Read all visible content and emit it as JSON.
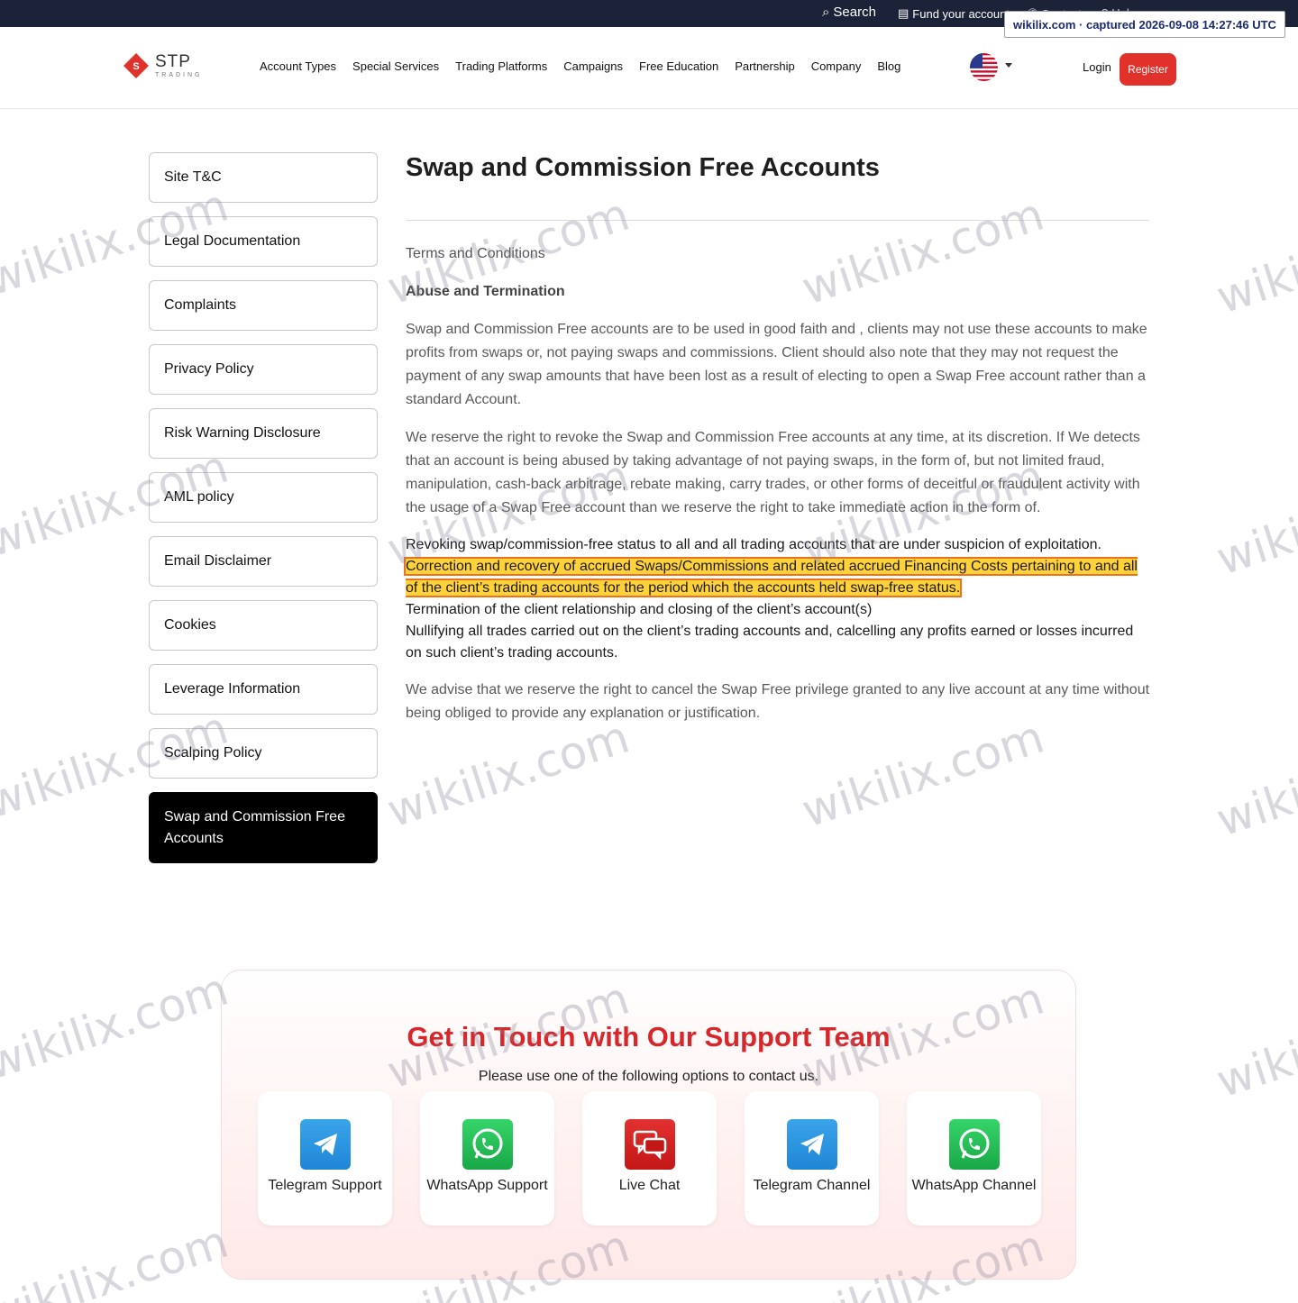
{
  "topbar": {
    "search": "Search",
    "fund": "Fund your account",
    "contact": "Contact",
    "help": "Help",
    "capture": "wikilix.com · captured 2026-09-08 14:27:46 UTC"
  },
  "header": {
    "logo_name": "STP",
    "logo_sub": "TRADING",
    "nav": [
      "Account Types",
      "Special Services",
      "Trading Platforms",
      "Campaigns",
      "Free Education",
      "Partnership",
      "Company",
      "Blog"
    ],
    "login": "Login",
    "register": "Register"
  },
  "sidebar": {
    "items": [
      {
        "label": "Site T&C"
      },
      {
        "label": "Legal Documentation"
      },
      {
        "label": "Complaints"
      },
      {
        "label": "Privacy Policy"
      },
      {
        "label": "Risk Warning Disclosure"
      },
      {
        "label": "AML policy"
      },
      {
        "label": "Email Disclaimer"
      },
      {
        "label": "Cookies"
      },
      {
        "label": "Leverage Information"
      },
      {
        "label": "Scalping Policy"
      },
      {
        "label": "Swap and Commission Free Accounts"
      }
    ]
  },
  "main": {
    "title": "Swap and Commission Free Accounts",
    "section": "Terms and Conditions",
    "subsection": "Abuse and Termination",
    "p1": "Swap and Commission Free accounts are to be used in good faith and , clients may not use these accounts to make profits from swaps or, not paying swaps and commissions. Client should also note that they may not request the payment of any swap amounts that have been lost as a result of electing to open a Swap Free account rather than a standard Account.",
    "p2": "We reserve the right to revoke the Swap and Commission Free accounts at any time, at its discretion. If We detects that an account is being abused by taking advantage of not paying swaps, in the form of, but not limited fraud, manipulation, cash-back arbitrage, rebate making, carry trades, or other forms of deceitful or fraudulent activity with the usage of a Swap Free account than we reserve the right to take immediate action in the form of.",
    "list": [
      "Revoking swap/commission-free status to all and all trading accounts that are under suspicion of exploitation.",
      "Correction and recovery of accrued Swaps/Commissions and related accrued Financing Costs pertaining to and all of the client’s trading accounts for the period which the accounts held swap-free status.",
      "Termination of the client relationship and closing of the client’s account(s)",
      "Nullifying all trades carried out on the client’s trading accounts and, calcelling any profits earned or losses incurred on such client’s trading accounts."
    ],
    "p3": "We advise that we reserve the right to cancel the Swap Free privilege granted to any live account at any time without being obliged to provide any explanation or justification."
  },
  "support": {
    "title": "Get in Touch with Our Support Team",
    "subtitle": "Please use one of the following options to contact us.",
    "options": [
      {
        "label": "Telegram Support",
        "icon": "telegram-icon"
      },
      {
        "label": "WhatsApp Support",
        "icon": "whatsapp-icon"
      },
      {
        "label": "Live Chat",
        "icon": "chat-icon"
      },
      {
        "label": "Telegram Channel",
        "icon": "telegram-icon"
      },
      {
        "label": "WhatsApp Channel",
        "icon": "whatsapp-icon"
      }
    ]
  },
  "watermark": "wikilix.com",
  "colors": {
    "brand_red": "#e0312b",
    "topbar": "#1c2237",
    "highlight": "#ffd23a",
    "highlight_border": "#e9731e",
    "support_title": "#d9262a"
  }
}
